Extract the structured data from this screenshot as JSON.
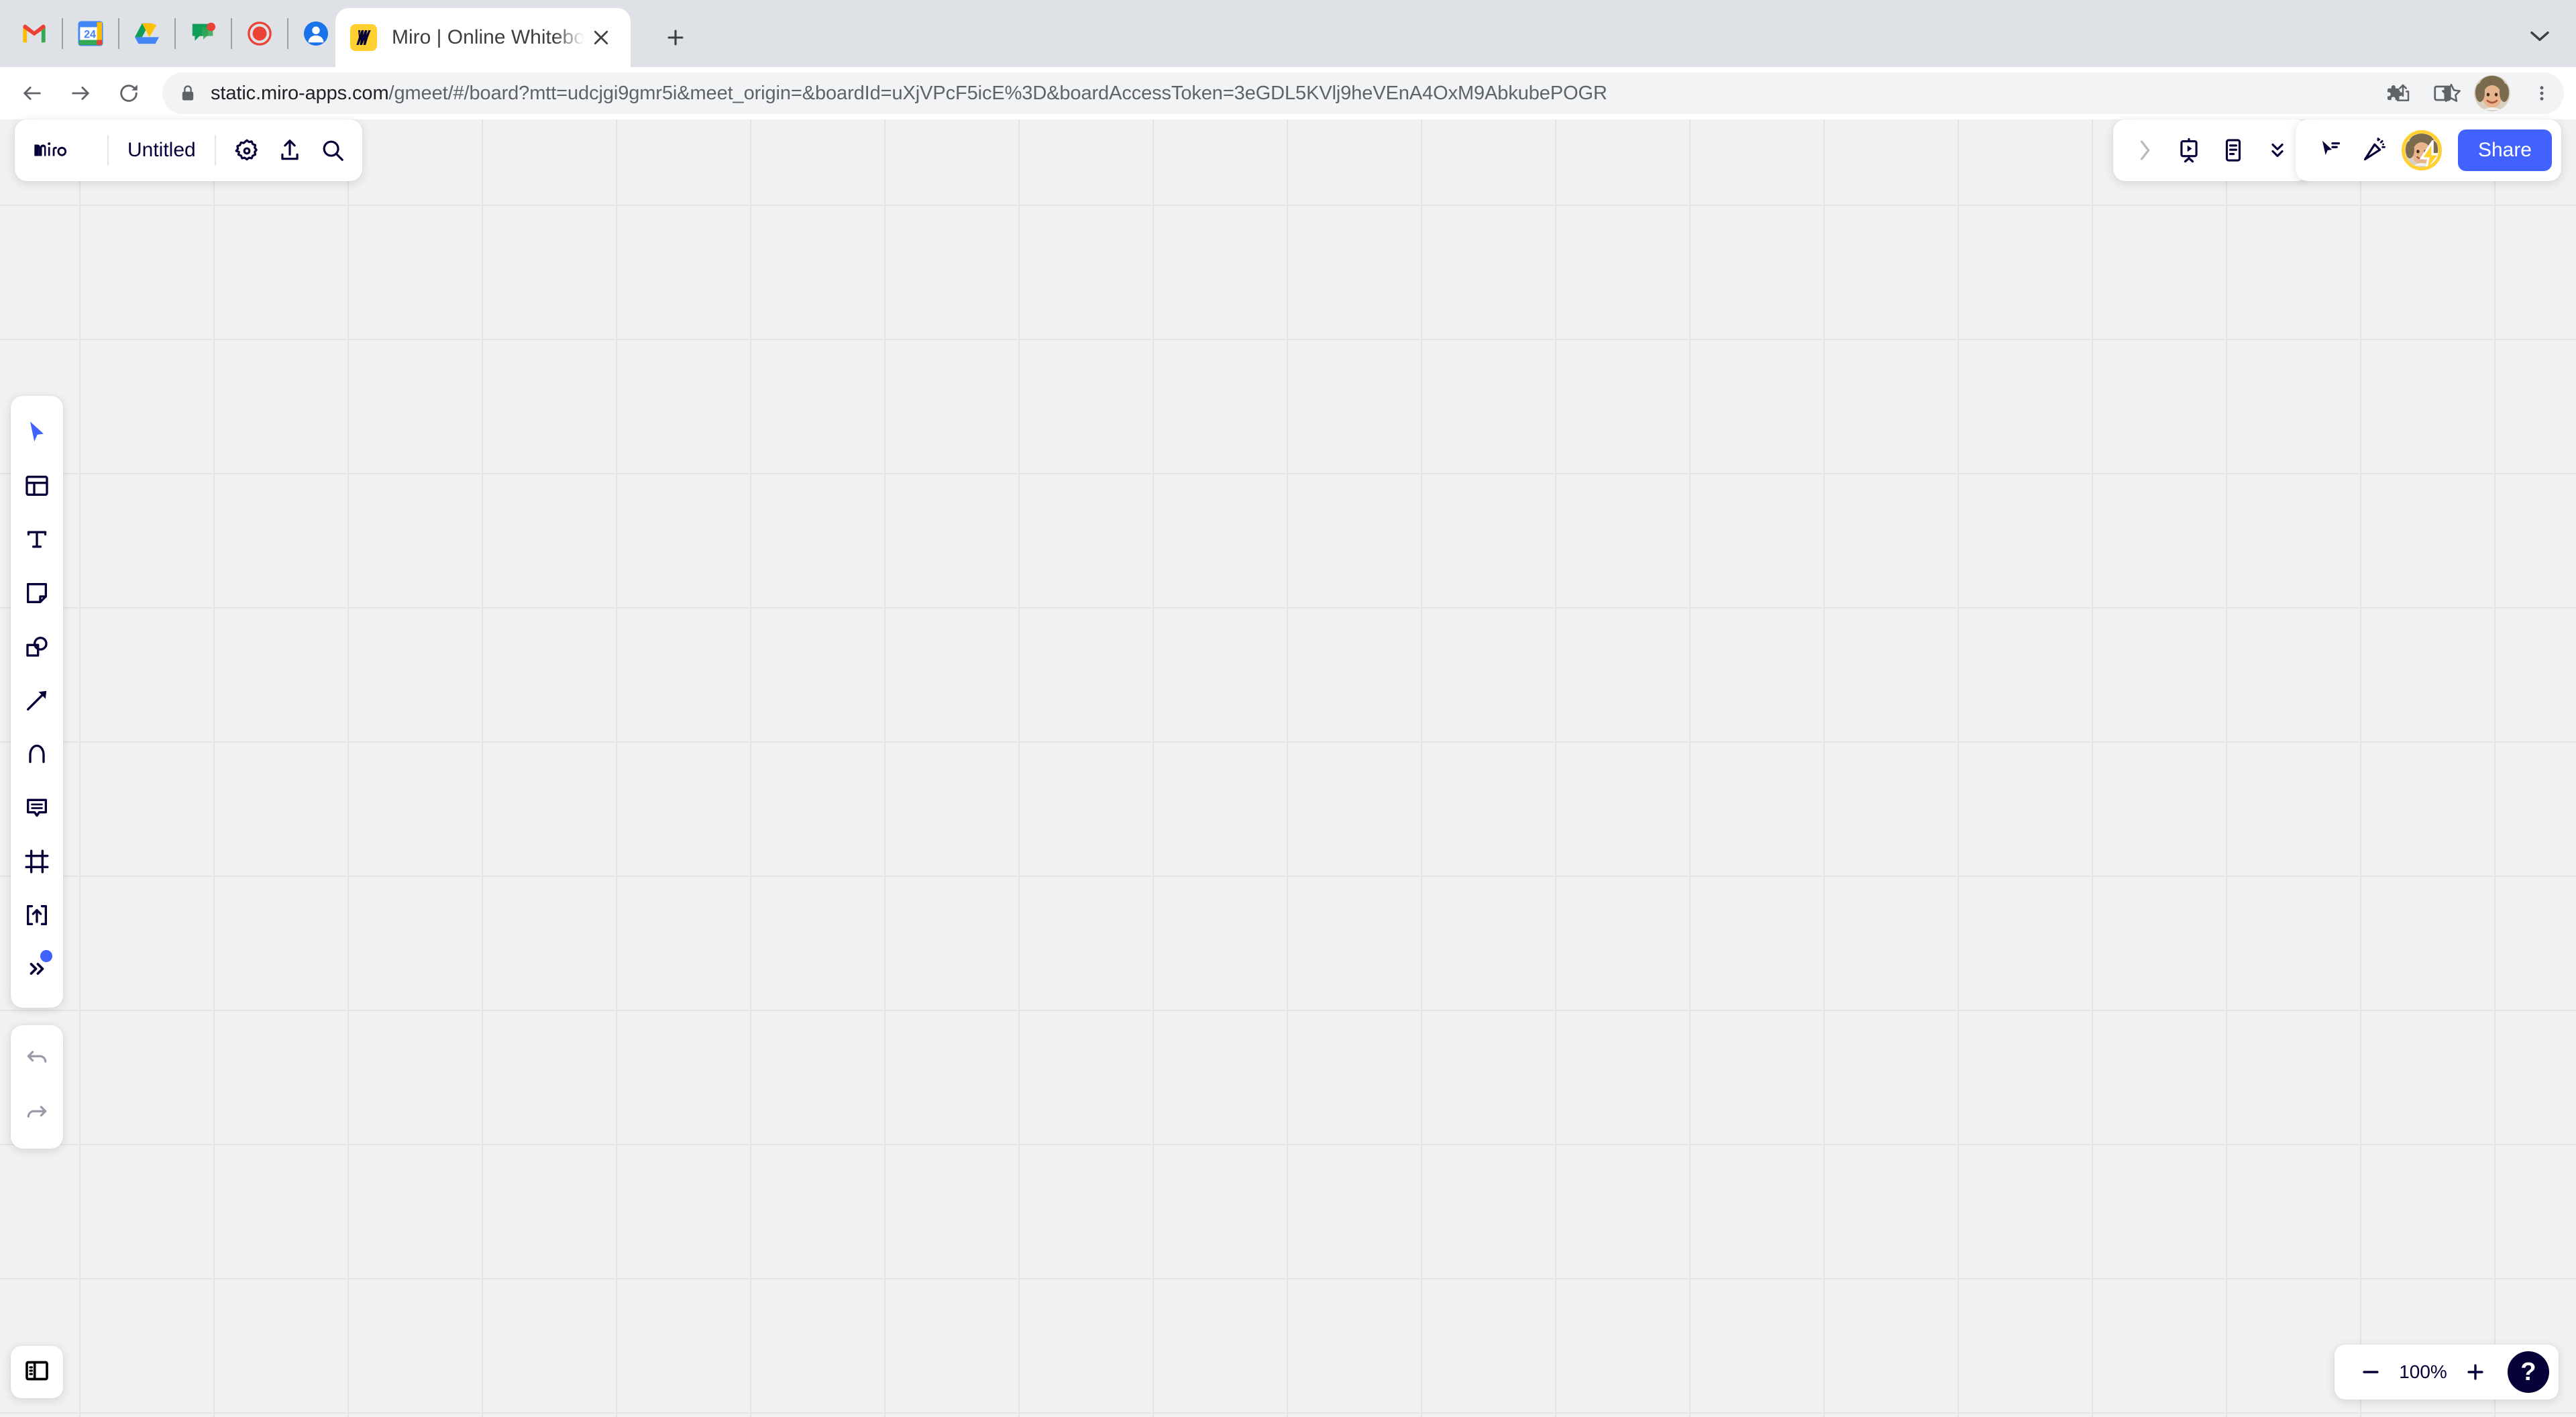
{
  "browser": {
    "quick_icons": [
      "gmail-icon",
      "google-calendar-icon",
      "google-drive-icon",
      "google-chat-icon",
      "record-icon",
      "contacts-icon"
    ],
    "tab": {
      "title": "Miro | Online Whiteboard for Vis",
      "favicon": "miro-favicon",
      "close_label": "×"
    },
    "newtab_label": "+",
    "url_secure_prefix": "static.miro-apps.com",
    "url_path": "/gmeet/#/board?mtt=udcjgi9gmr5i&meet_origin=&boardId=uXjVPcF5icE%3D&boardAccessToken=3eGDL5KVlj9heVEnA4OxM9AbkubePOGR",
    "toolbar_icons": [
      "share-icon",
      "bookmark-star-icon",
      "extensions-puzzle-icon",
      "side-panel-icon",
      "profile-avatar",
      "chrome-menu-icon"
    ],
    "nav_icons": [
      "back-arrow-icon",
      "forward-arrow-icon",
      "reload-icon"
    ]
  },
  "miro": {
    "logo": "miro-logo",
    "board_title": "Untitled",
    "header_icons": [
      "settings-gear-icon",
      "upload-icon",
      "search-icon"
    ],
    "top_right_group1": [
      "expand-chevron-icon",
      "presentation-icon",
      "notes-icon",
      "double-chevron-down-icon"
    ],
    "top_right_group2": [
      "cursor-select-icon",
      "celebrate-icon"
    ],
    "share_label": "Share",
    "toolbar": [
      {
        "name": "select-tool",
        "icon": "cursor-arrow-icon",
        "active": true
      },
      {
        "name": "templates-tool",
        "icon": "templates-icon",
        "active": false
      },
      {
        "name": "text-tool",
        "icon": "text-t-icon",
        "active": false
      },
      {
        "name": "sticky-note-tool",
        "icon": "sticky-note-icon",
        "active": false
      },
      {
        "name": "shapes-tool",
        "icon": "shapes-icon",
        "active": false
      },
      {
        "name": "connector-tool",
        "icon": "arrow-connector-icon",
        "active": false
      },
      {
        "name": "pen-tool",
        "icon": "pen-icon",
        "active": false
      },
      {
        "name": "comment-tool",
        "icon": "comment-bubble-icon",
        "active": false
      },
      {
        "name": "frame-tool",
        "icon": "frame-icon",
        "active": false
      },
      {
        "name": "upload-tool",
        "icon": "upload-box-icon",
        "active": false
      },
      {
        "name": "more-tools",
        "icon": "double-chevron-right-icon",
        "active": false,
        "badge": true
      }
    ],
    "undo_label": "undo-icon",
    "redo_label": "redo-icon",
    "bottom_left_icon": "toggle-panel-icon",
    "zoom": {
      "minus_label": "−",
      "value": "100%",
      "plus_label": "+",
      "help_label": "?"
    }
  },
  "colors": {
    "miro_brand_yellow": "#ffd02f",
    "miro_navy": "#050038",
    "accent_blue": "#4262ff",
    "canvas_bg": "#f1f1f0",
    "grid_line": "#e3e3e1",
    "browser_chrome": "#dee1e6"
  }
}
